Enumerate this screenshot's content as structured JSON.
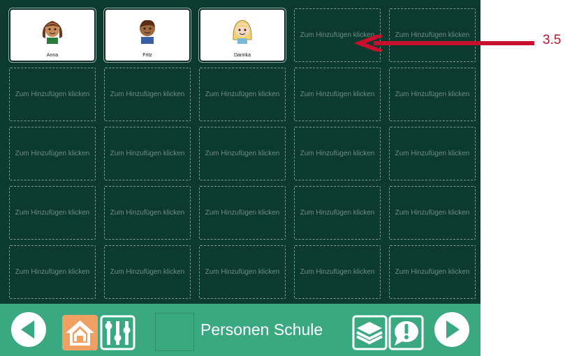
{
  "grid": {
    "placeholder_label": "Zum Hinzufügen klicken",
    "filled": [
      {
        "name": "Anna",
        "icon": "girl-braids-icon"
      },
      {
        "name": "Fritz",
        "icon": "boy-icon"
      },
      {
        "name": "Darinka",
        "icon": "girl-blonde-icon"
      }
    ],
    "rows": 5,
    "cols": 5
  },
  "toolbar": {
    "title": "Personen Schule",
    "back_icon": "arrow-left-icon",
    "home_icon": "home-icon",
    "settings_icon": "sliders-icon",
    "layers_icon": "layers-icon",
    "alert_icon": "exclamation-bubble-icon",
    "forward_icon": "arrow-right-icon"
  },
  "annotation": {
    "label": "3.5",
    "color": "#c8102e"
  },
  "colors": {
    "board_bg": "#0c3a2f",
    "toolbar_bg": "#3aa880",
    "home_bg": "#f0a063"
  }
}
